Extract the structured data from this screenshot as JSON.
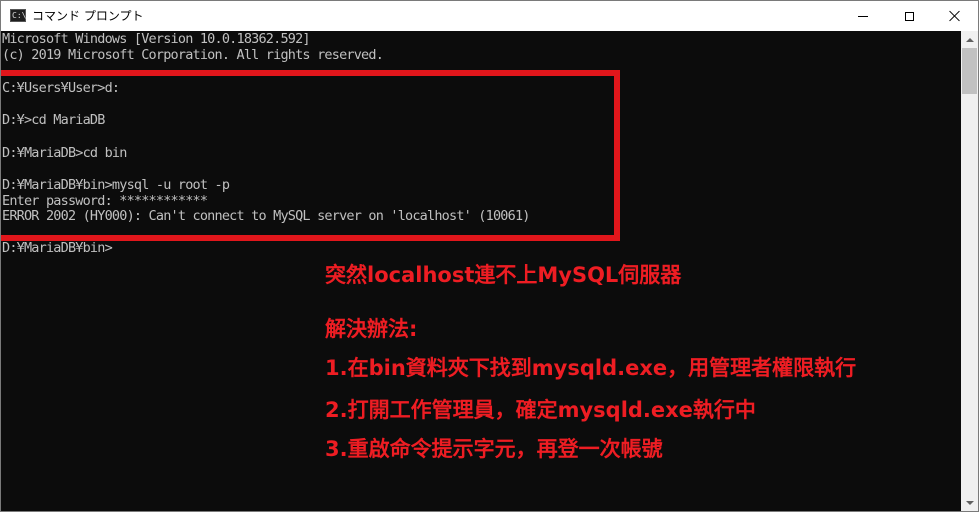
{
  "window": {
    "title": "コマンド プロンプト",
    "icon": "cmd-icon"
  },
  "console": {
    "lines": [
      "Microsoft Windows [Version 10.0.18362.592]",
      "(c) 2019 Microsoft Corporation. All rights reserved.",
      "C:¥Users¥User>d:",
      "D:¥>cd MariaDB",
      "D:¥MariaDB>cd bin",
      "D:¥MariaDB¥bin>mysql -u root -p",
      "Enter password: ************",
      "ERROR 2002 (HY000): Can't connect to MySQL server on 'localhost' (10061)",
      "D:¥MariaDB¥bin>"
    ]
  },
  "annotations": {
    "heading": "突然localhost連不上MySQL伺服器",
    "solution_title": "解決辦法:",
    "steps": [
      "1.在bin資料夾下找到mysqld.exe，用管理者權限執行",
      "2.打開工作管理員，確定mysqld.exe執行中",
      "3.重啟命令提示字元，再登一次帳號"
    ],
    "accent_color": "#ee1d23"
  },
  "colors": {
    "console_bg": "#0c0c0c",
    "console_text": "#c0c0c0"
  }
}
